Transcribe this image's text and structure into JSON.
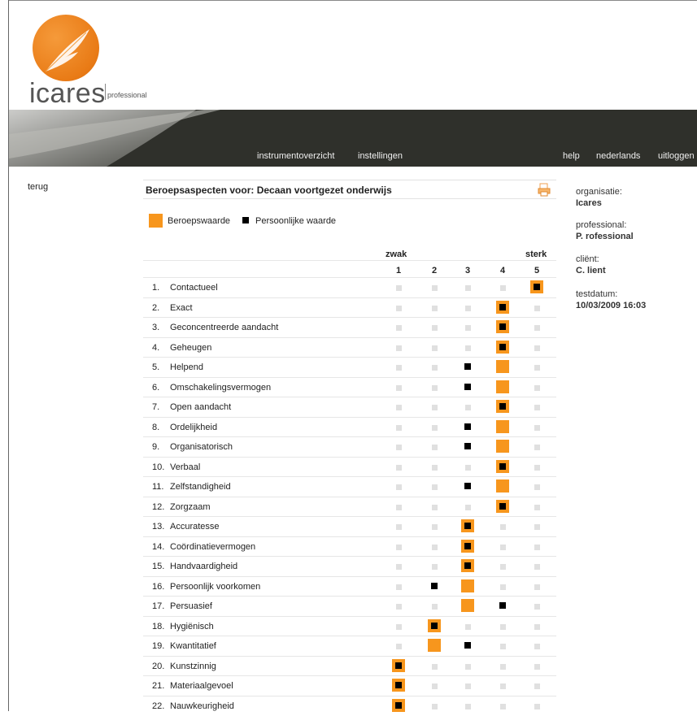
{
  "brand": {
    "name": "icares",
    "sub": "professional",
    "accent": "#f7961d"
  },
  "nav": {
    "left": [
      "instrumentoverzicht",
      "instellingen"
    ],
    "right": [
      "help",
      "nederlands",
      "uitloggen"
    ]
  },
  "back_label": "terug",
  "title": "Beroepsaspecten voor: Decaan voortgezet onderwijs",
  "legend": {
    "orange_label": "Beroepswaarde",
    "black_label": "Persoonlijke waarde"
  },
  "scale": {
    "low": "zwak",
    "high": "sterk",
    "columns": [
      "1",
      "2",
      "3",
      "4",
      "5"
    ]
  },
  "rows": [
    {
      "n": "1.",
      "label": "Contactueel",
      "beroep": 5,
      "persoonlijk": 5
    },
    {
      "n": "2.",
      "label": "Exact",
      "beroep": 4,
      "persoonlijk": 4
    },
    {
      "n": "3.",
      "label": "Geconcentreerde aandacht",
      "beroep": 4,
      "persoonlijk": 4
    },
    {
      "n": "4.",
      "label": "Geheugen",
      "beroep": 4,
      "persoonlijk": 4
    },
    {
      "n": "5.",
      "label": "Helpend",
      "beroep": 4,
      "persoonlijk": 3
    },
    {
      "n": "6.",
      "label": "Omschakelingsvermogen",
      "beroep": 4,
      "persoonlijk": 3
    },
    {
      "n": "7.",
      "label": "Open aandacht",
      "beroep": 4,
      "persoonlijk": 4
    },
    {
      "n": "8.",
      "label": "Ordelijkheid",
      "beroep": 4,
      "persoonlijk": 3
    },
    {
      "n": "9.",
      "label": "Organisatorisch",
      "beroep": 4,
      "persoonlijk": 3
    },
    {
      "n": "10.",
      "label": "Verbaal",
      "beroep": 4,
      "persoonlijk": 4
    },
    {
      "n": "11.",
      "label": "Zelfstandigheid",
      "beroep": 4,
      "persoonlijk": 3
    },
    {
      "n": "12.",
      "label": "Zorgzaam",
      "beroep": 4,
      "persoonlijk": 4
    },
    {
      "n": "13.",
      "label": "Accuratesse",
      "beroep": 3,
      "persoonlijk": 3
    },
    {
      "n": "14.",
      "label": "Coördinatievermogen",
      "beroep": 3,
      "persoonlijk": 3
    },
    {
      "n": "15.",
      "label": "Handvaardigheid",
      "beroep": 3,
      "persoonlijk": 3
    },
    {
      "n": "16.",
      "label": "Persoonlijk voorkomen",
      "beroep": 3,
      "persoonlijk": 2
    },
    {
      "n": "17.",
      "label": "Persuasief",
      "beroep": 3,
      "persoonlijk": 4
    },
    {
      "n": "18.",
      "label": "Hygiënisch",
      "beroep": 2,
      "persoonlijk": 2
    },
    {
      "n": "19.",
      "label": "Kwantitatief",
      "beroep": 2,
      "persoonlijk": 3
    },
    {
      "n": "20.",
      "label": "Kunstzinnig",
      "beroep": 1,
      "persoonlijk": 1
    },
    {
      "n": "21.",
      "label": "Materiaalgevoel",
      "beroep": 1,
      "persoonlijk": 1
    },
    {
      "n": "22.",
      "label": "Nauwkeurigheid",
      "beroep": 1,
      "persoonlijk": 1
    }
  ],
  "info": [
    {
      "key": "organisatie:",
      "value": "Icares"
    },
    {
      "key": "professional:",
      "value": "P. rofessional"
    },
    {
      "key": "cliënt:",
      "value": "C. lient"
    },
    {
      "key": "testdatum:",
      "value": "10/03/2009 16:03"
    }
  ]
}
